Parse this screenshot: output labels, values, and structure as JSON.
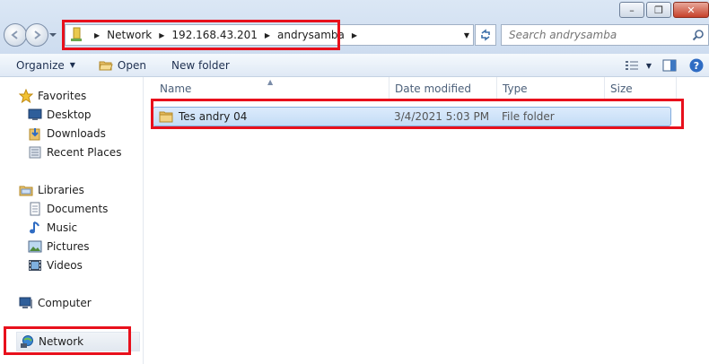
{
  "window": {
    "minimize_glyph": "–",
    "maximize_glyph": "❐",
    "close_glyph": "✕"
  },
  "address": {
    "segments": [
      "Network",
      "192.168.43.201",
      "andrysamba"
    ]
  },
  "search": {
    "placeholder": "Search andrysamba"
  },
  "toolbar": {
    "organize": "Organize",
    "open": "Open",
    "new_folder": "New folder"
  },
  "sidebar": {
    "favorites": "Favorites",
    "desktop": "Desktop",
    "downloads": "Downloads",
    "recent_places": "Recent Places",
    "libraries": "Libraries",
    "documents": "Documents",
    "music": "Music",
    "pictures": "Pictures",
    "videos": "Videos",
    "computer": "Computer",
    "network": "Network"
  },
  "columns": {
    "name": "Name",
    "date_modified": "Date modified",
    "type": "Type",
    "size": "Size"
  },
  "files": [
    {
      "name": "Tes andry 04",
      "date_modified": "3/4/2021 5:03 PM",
      "type": "File folder",
      "size": ""
    }
  ],
  "colors": {
    "highlight": "#e8101c",
    "selection": "#c3dcf6"
  }
}
